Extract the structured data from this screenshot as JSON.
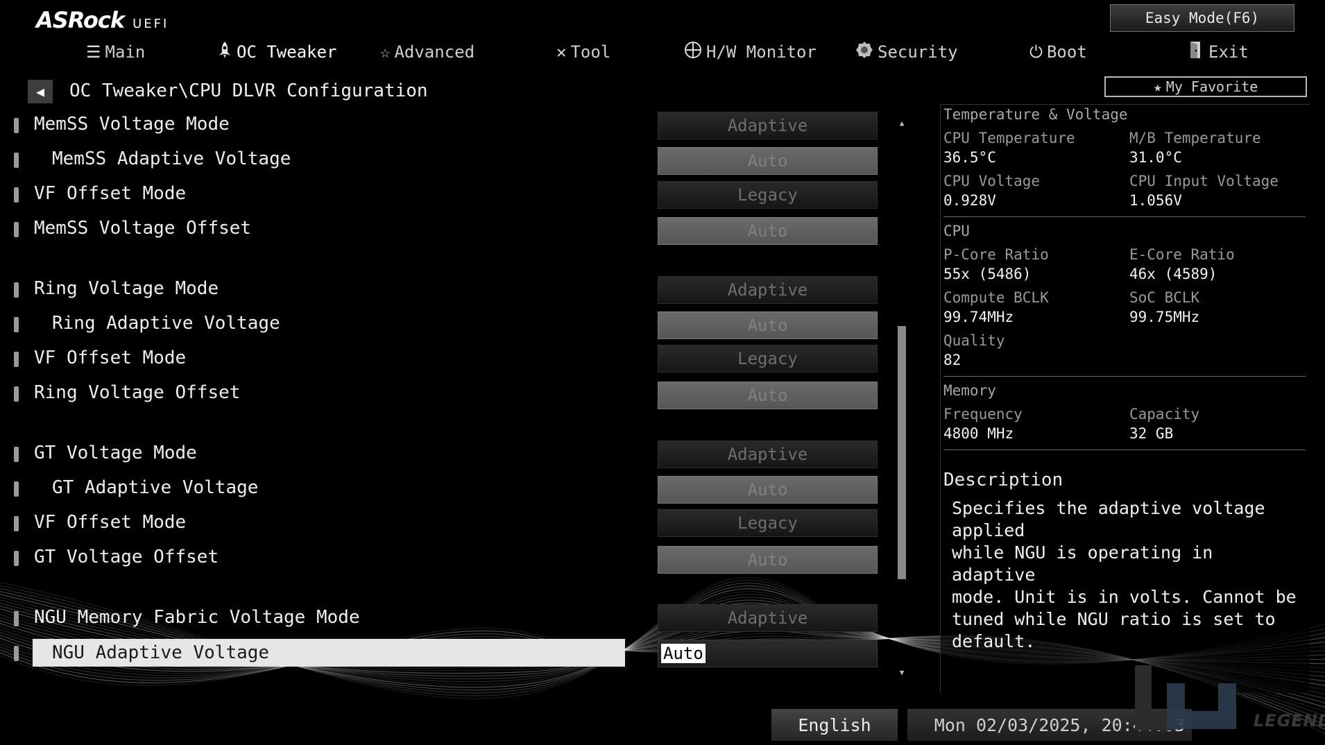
{
  "logo": {
    "brand": "ASRock",
    "suffix": "UEFI"
  },
  "nav": [
    {
      "label": "Main",
      "icon": "list-icon",
      "active": false
    },
    {
      "label": "OC Tweaker",
      "icon": "rocket-icon",
      "active": true
    },
    {
      "label": "Advanced",
      "icon": "star-icon",
      "active": false
    },
    {
      "label": "Tool",
      "icon": "wrench-icon",
      "active": false
    },
    {
      "label": "H/W Monitor",
      "icon": "crosshair-icon",
      "active": false
    },
    {
      "label": "Security",
      "icon": "shield-icon",
      "active": false
    },
    {
      "label": "Boot",
      "icon": "power-icon",
      "active": false
    },
    {
      "label": "Exit",
      "icon": "exit-icon",
      "active": false
    }
  ],
  "easy_mode": "Easy Mode(F6)",
  "my_favorite": "My Favorite",
  "breadcrumb": "OC Tweaker\\CPU DLVR Configuration",
  "settings": [
    {
      "label": "MemSS Voltage Mode",
      "value": "Adaptive",
      "indent": false,
      "style": "dark"
    },
    {
      "label": "MemSS Adaptive Voltage",
      "value": "Auto",
      "indent": true,
      "style": "light"
    },
    {
      "label": "VF Offset Mode",
      "value": "Legacy",
      "indent": false,
      "style": "dark"
    },
    {
      "label": "MemSS Voltage Offset",
      "value": "Auto",
      "indent": false,
      "style": "light"
    },
    {
      "label": "Ring Voltage Mode",
      "value": "Adaptive",
      "indent": false,
      "style": "dark"
    },
    {
      "label": "Ring Adaptive Voltage",
      "value": "Auto",
      "indent": true,
      "style": "light"
    },
    {
      "label": "VF Offset Mode",
      "value": "Legacy",
      "indent": false,
      "style": "dark"
    },
    {
      "label": "Ring Voltage Offset",
      "value": "Auto",
      "indent": false,
      "style": "light"
    },
    {
      "label": "GT Voltage Mode",
      "value": "Adaptive",
      "indent": false,
      "style": "dark"
    },
    {
      "label": "GT Adaptive Voltage",
      "value": "Auto",
      "indent": true,
      "style": "light"
    },
    {
      "label": "VF Offset Mode",
      "value": "Legacy",
      "indent": false,
      "style": "dark"
    },
    {
      "label": "GT Voltage Offset",
      "value": "Auto",
      "indent": false,
      "style": "light"
    },
    {
      "label": "NGU Memory Fabric Voltage Mode",
      "value": "Adaptive",
      "indent": false,
      "style": "dark"
    },
    {
      "label": "NGU Adaptive Voltage",
      "value": "Auto",
      "indent": true,
      "style": "current",
      "selected": true
    }
  ],
  "info": {
    "temp_volt": {
      "title": "Temperature & Voltage",
      "cpu_temp_label": "CPU Temperature",
      "cpu_temp": "36.5°C",
      "mb_temp_label": "M/B Temperature",
      "mb_temp": "31.0°C",
      "cpu_volt_label": "CPU Voltage",
      "cpu_volt": "0.928V",
      "cpu_input_label": "CPU Input Voltage",
      "cpu_input": "1.056V"
    },
    "cpu": {
      "title": "CPU",
      "pcore_label": "P-Core Ratio",
      "pcore": "55x (5486)",
      "ecore_label": "E-Core Ratio",
      "ecore": "46x (4589)",
      "compute_bclk_label": "Compute BCLK",
      "compute_bclk": "99.74MHz",
      "soc_bclk_label": "SoC BCLK",
      "soc_bclk": "99.75MHz",
      "quality_label": "Quality",
      "quality": "82"
    },
    "memory": {
      "title": "Memory",
      "freq_label": "Frequency",
      "freq": "4800 MHz",
      "cap_label": "Capacity",
      "cap": "32 GB"
    },
    "description_title": "Description",
    "description": "Specifies the adaptive voltage applied\nwhile NGU is operating in adaptive\nmode. Unit is in volts. Cannot be\ntuned while NGU ratio is set to\ndefault."
  },
  "footer": {
    "language": "English",
    "datetime": "Mon 02/03/2025, 20:44:03"
  },
  "watermark": {
    "text": "LEGEND"
  }
}
